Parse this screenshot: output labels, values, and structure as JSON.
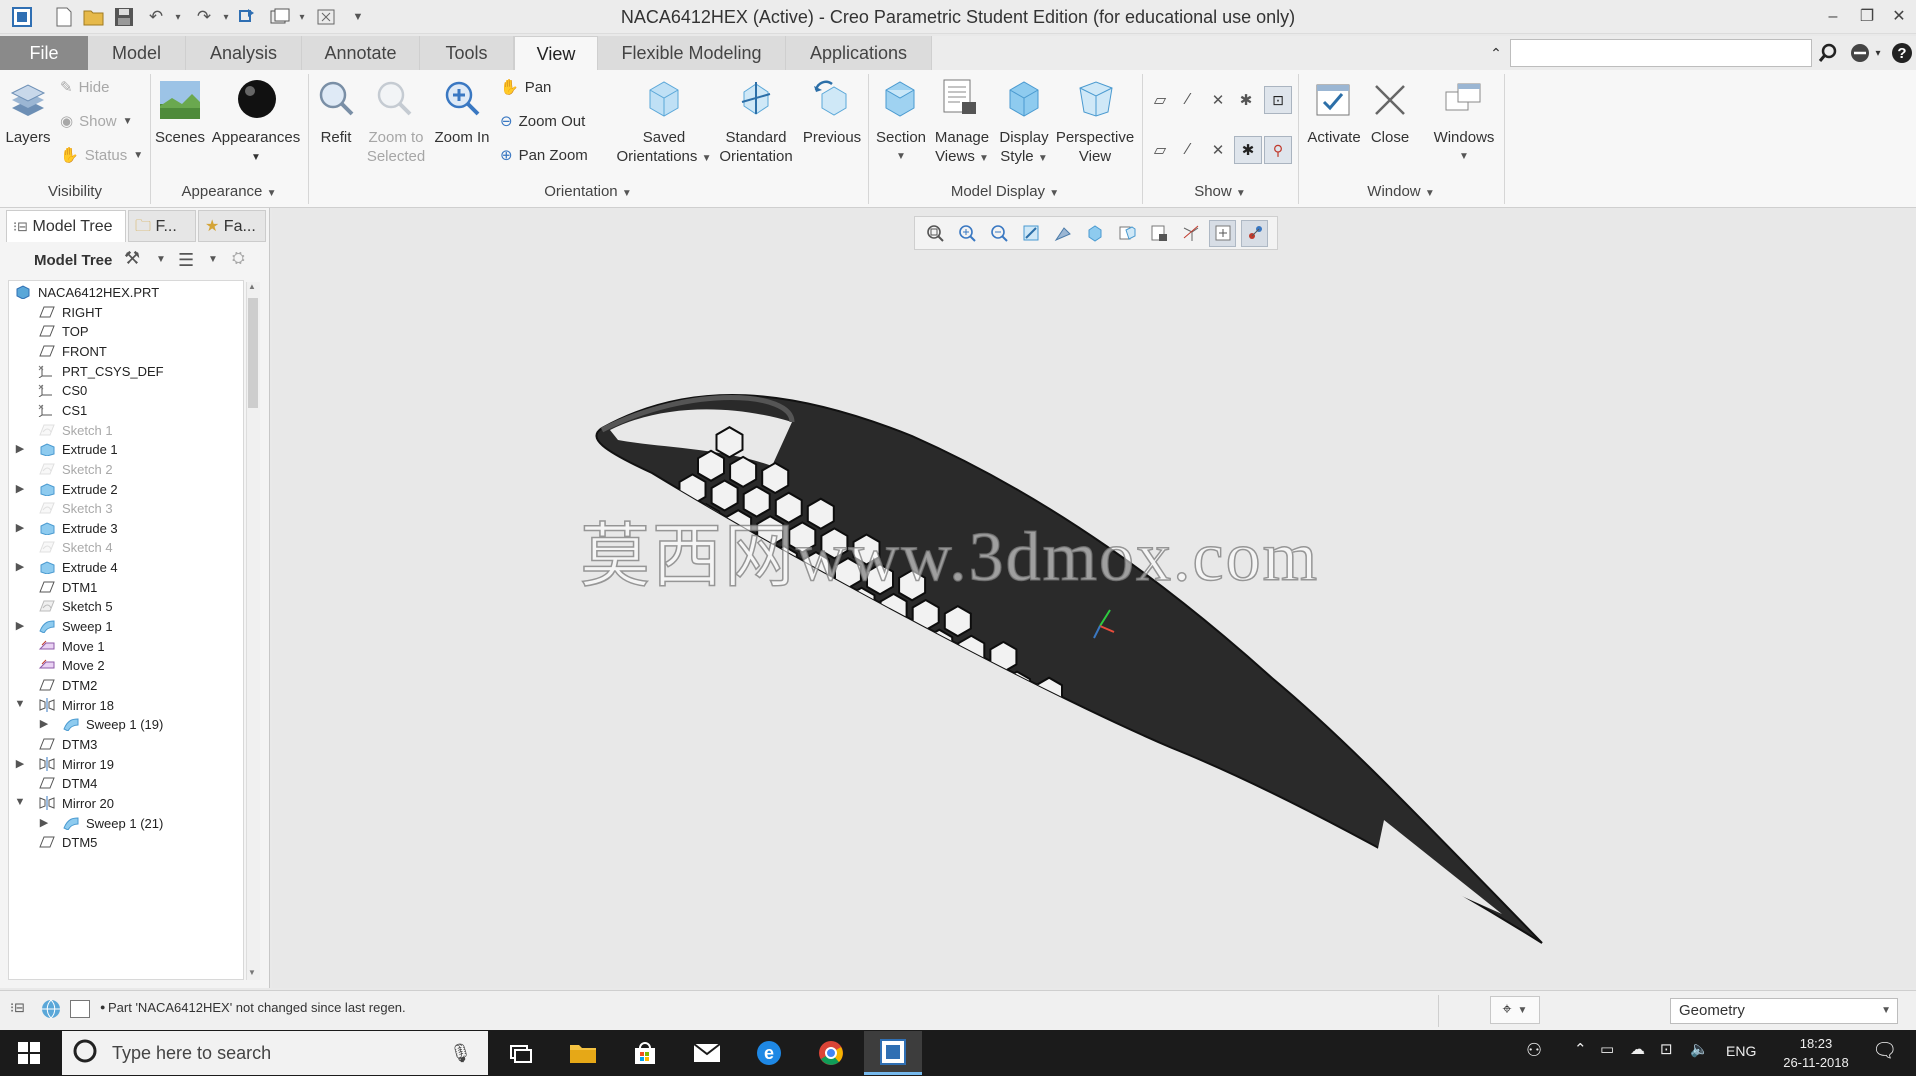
{
  "window": {
    "title": "NACA6412HEX (Active) - Creo Parametric Student Edition (for educational use only)",
    "minimize": "–",
    "restore": "❐",
    "close": "✕"
  },
  "tabs": [
    {
      "label": "File"
    },
    {
      "label": "Model"
    },
    {
      "label": "Analysis"
    },
    {
      "label": "Annotate"
    },
    {
      "label": "Tools"
    },
    {
      "label": "View"
    },
    {
      "label": "Flexible Modeling"
    },
    {
      "label": "Applications"
    }
  ],
  "ribbon": {
    "visibility": {
      "layers": "Layers",
      "hide": "Hide",
      "show": "Show",
      "status": "Status",
      "label": "Visibility"
    },
    "appearance": {
      "scenes": "Scenes",
      "appearances": "Appearances",
      "label": "Appearance"
    },
    "orientation": {
      "refit": "Refit",
      "zoom_to_selected_1": "Zoom to",
      "zoom_to_selected_2": "Selected",
      "zoom_in": "Zoom In",
      "pan": "Pan",
      "zoom_out": "Zoom Out",
      "pan_zoom": "Pan Zoom",
      "saved_1": "Saved",
      "saved_2": "Orientations",
      "standard_1": "Standard",
      "standard_2": "Orientation",
      "previous": "Previous",
      "label": "Orientation"
    },
    "model_display": {
      "section": "Section",
      "manage_1": "Manage",
      "manage_2": "Views",
      "display_1": "Display",
      "display_2": "Style",
      "persp_1": "Perspective",
      "persp_2": "View",
      "label": "Model Display"
    },
    "show": {
      "label": "Show"
    },
    "window": {
      "activate": "Activate",
      "close": "Close",
      "windows": "Windows",
      "label": "Window"
    }
  },
  "left_panel": {
    "tabs": [
      "Model Tree",
      "F...",
      "Fa..."
    ],
    "header": "Model Tree",
    "tree": [
      {
        "label": "NACA6412HEX.PRT",
        "icon": "part-icon",
        "level": 0,
        "expander": "",
        "dim": false
      },
      {
        "label": "RIGHT",
        "icon": "datum-plane-icon",
        "level": 1,
        "expander": "",
        "dim": false
      },
      {
        "label": "TOP",
        "icon": "datum-plane-icon",
        "level": 1,
        "expander": "",
        "dim": false
      },
      {
        "label": "FRONT",
        "icon": "datum-plane-icon",
        "level": 1,
        "expander": "",
        "dim": false
      },
      {
        "label": "PRT_CSYS_DEF",
        "icon": "csys-icon",
        "level": 1,
        "expander": "",
        "dim": false
      },
      {
        "label": "CS0",
        "icon": "csys-icon",
        "level": 1,
        "expander": "",
        "dim": false
      },
      {
        "label": "CS1",
        "icon": "csys-icon",
        "level": 1,
        "expander": "",
        "dim": false
      },
      {
        "label": "Sketch 1",
        "icon": "sketch-icon",
        "level": 1,
        "expander": "",
        "dim": true
      },
      {
        "label": "Extrude 1",
        "icon": "extrude-icon",
        "level": 1,
        "expander": "▶",
        "dim": false
      },
      {
        "label": "Sketch 2",
        "icon": "sketch-icon",
        "level": 1,
        "expander": "",
        "dim": true
      },
      {
        "label": "Extrude 2",
        "icon": "extrude-icon",
        "level": 1,
        "expander": "▶",
        "dim": false
      },
      {
        "label": "Sketch 3",
        "icon": "sketch-icon",
        "level": 1,
        "expander": "",
        "dim": true
      },
      {
        "label": "Extrude 3",
        "icon": "extrude-icon",
        "level": 1,
        "expander": "▶",
        "dim": false
      },
      {
        "label": "Sketch 4",
        "icon": "sketch-icon",
        "level": 1,
        "expander": "",
        "dim": true
      },
      {
        "label": "Extrude 4",
        "icon": "extrude-icon",
        "level": 1,
        "expander": "▶",
        "dim": false
      },
      {
        "label": "DTM1",
        "icon": "datum-plane-icon",
        "level": 1,
        "expander": "",
        "dim": false
      },
      {
        "label": "Sketch 5",
        "icon": "sketch-icon",
        "level": 1,
        "expander": "",
        "dim": false
      },
      {
        "label": "Sweep 1",
        "icon": "sweep-icon",
        "level": 1,
        "expander": "▶",
        "dim": false
      },
      {
        "label": "Move 1",
        "icon": "move-icon",
        "level": 1,
        "expander": "",
        "dim": false
      },
      {
        "label": "Move 2",
        "icon": "move-icon",
        "level": 1,
        "expander": "",
        "dim": false
      },
      {
        "label": "DTM2",
        "icon": "datum-plane-icon",
        "level": 1,
        "expander": "",
        "dim": false
      },
      {
        "label": "Mirror 18",
        "icon": "mirror-icon",
        "level": 1,
        "expander": "▼",
        "dim": false
      },
      {
        "label": "Sweep 1 (19)",
        "icon": "sweep-icon",
        "level": 2,
        "expander": "▶",
        "dim": false
      },
      {
        "label": "DTM3",
        "icon": "datum-plane-icon",
        "level": 1,
        "expander": "",
        "dim": false
      },
      {
        "label": "Mirror 19",
        "icon": "mirror-icon",
        "level": 1,
        "expander": "▶",
        "dim": false
      },
      {
        "label": "DTM4",
        "icon": "datum-plane-icon",
        "level": 1,
        "expander": "",
        "dim": false
      },
      {
        "label": "Mirror 20",
        "icon": "mirror-icon",
        "level": 1,
        "expander": "▼",
        "dim": false
      },
      {
        "label": "Sweep 1 (21)",
        "icon": "sweep-icon",
        "level": 2,
        "expander": "▶",
        "dim": false
      },
      {
        "label": "DTM5",
        "icon": "datum-plane-icon",
        "level": 1,
        "expander": "",
        "dim": false
      }
    ]
  },
  "graphics": {
    "watermark": "莫西网www.3dmox.com"
  },
  "status": {
    "message": "Part 'NACA6412HEX' not changed since last regen.",
    "filter": "Geometry"
  },
  "taskbar": {
    "search_placeholder": "Type here to search",
    "language": "ENG",
    "time": "18:23",
    "date": "26-11-2018"
  }
}
